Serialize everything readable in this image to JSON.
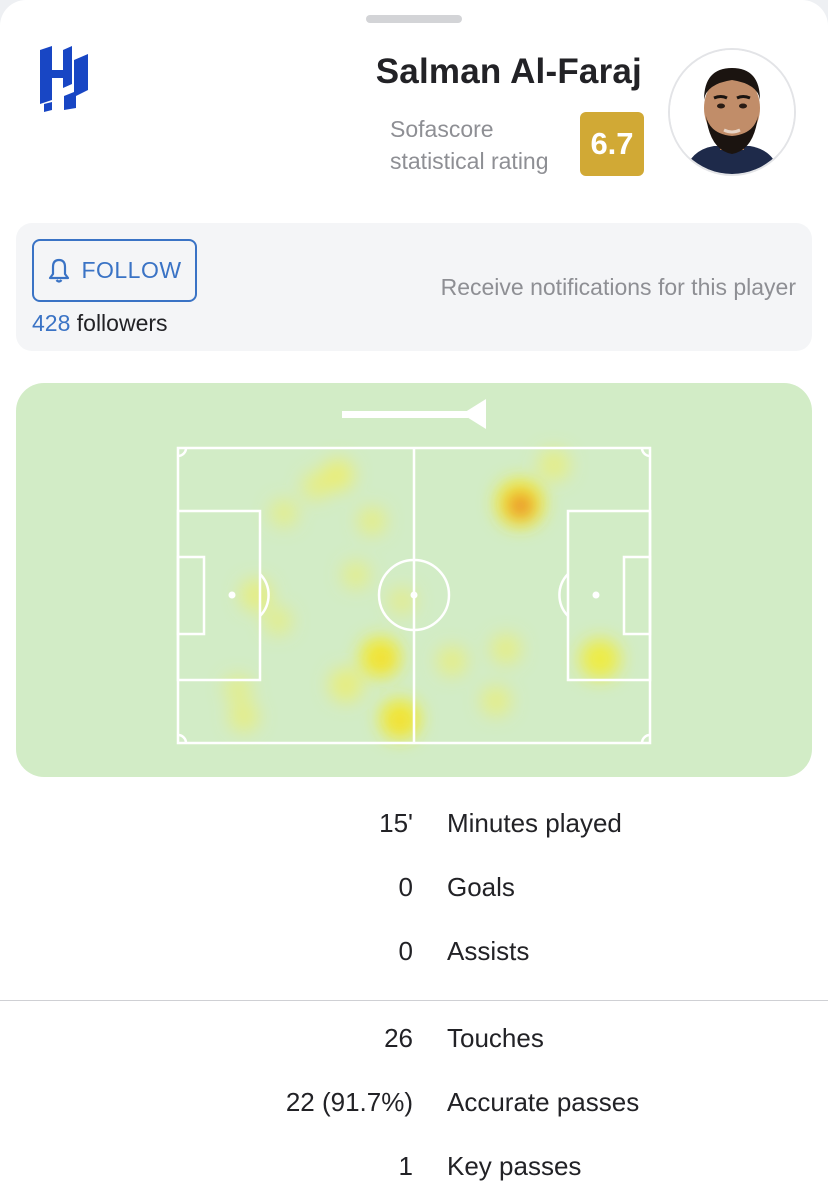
{
  "player": {
    "name": "Salman Al-Faraj",
    "rating_label_line1": "Sofascore",
    "rating_label_line2": "statistical rating",
    "rating": "6.7",
    "rating_color": "#d1a935",
    "club_logo": "al-hilal-logo"
  },
  "follow": {
    "button_label": "FOLLOW",
    "button_icon": "bell-icon",
    "followers_count": "428",
    "followers_label": "followers",
    "notify_text": "Receive notifications for this player",
    "accent_color": "#3a73c5"
  },
  "heatmap": {
    "attack_direction": "left",
    "pitch_color": "#d2ecc6"
  },
  "stats_primary": [
    {
      "value": "15'",
      "label": "Minutes played"
    },
    {
      "value": "0",
      "label": "Goals"
    },
    {
      "value": "0",
      "label": "Assists"
    }
  ],
  "stats_secondary": [
    {
      "value": "26",
      "label": "Touches"
    },
    {
      "value": "22 (91.7%)",
      "label": "Accurate passes"
    },
    {
      "value": "1",
      "label": "Key passes"
    }
  ]
}
